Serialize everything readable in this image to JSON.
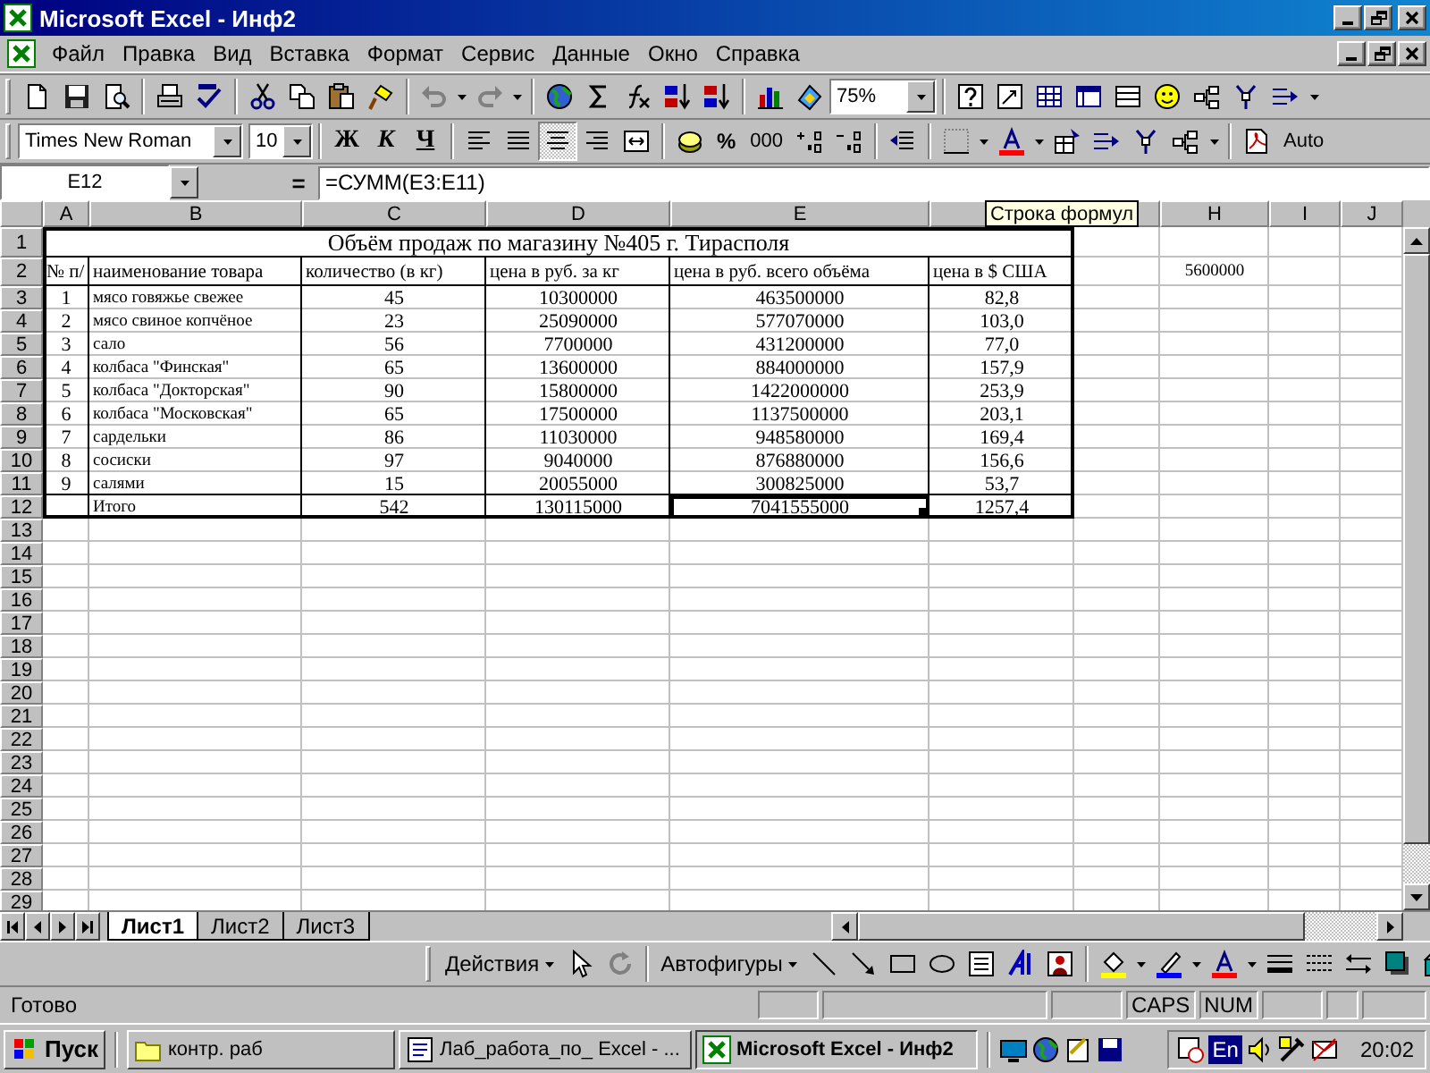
{
  "window": {
    "title": "Microsoft Excel - Инф2"
  },
  "menu": [
    "Файл",
    "Правка",
    "Вид",
    "Вставка",
    "Формат",
    "Сервис",
    "Данные",
    "Окно",
    "Справка"
  ],
  "standard_toolbar": {
    "zoom": "75%"
  },
  "formatting_toolbar": {
    "font": "Times New Roman",
    "size": "10",
    "style_buttons": [
      "Ж",
      "К",
      "Ч"
    ],
    "alignment": [
      {
        "kind": "left",
        "selected": false
      },
      {
        "kind": "justify",
        "selected": false
      },
      {
        "kind": "center",
        "selected": true
      },
      {
        "kind": "right",
        "selected": false
      }
    ],
    "percent": "%",
    "thousands": "000",
    "pdf_label": "Auto"
  },
  "formula_bar": {
    "name_box": "E12",
    "equals": "=",
    "formula": "=СУММ(E3:E11)"
  },
  "tooltip": "Строка формул",
  "sheet": {
    "column_headers": [
      "A",
      "B",
      "C",
      "D",
      "E",
      "H",
      "I",
      "J"
    ],
    "row_headers": [
      "1",
      "2",
      "3",
      "4",
      "5",
      "6",
      "7",
      "8",
      "9",
      "10",
      "11",
      "12",
      "13",
      "14",
      "15",
      "16",
      "17",
      "18",
      "19",
      "20",
      "21",
      "22",
      "23",
      "24",
      "25",
      "26",
      "27",
      "28",
      "29"
    ],
    "title": "Объём продаж по магазину №405 г. Тирасполя",
    "columns": [
      "№ п/",
      "наименование товара",
      "количество (в кг)",
      "цена в руб. за кг",
      "цена в руб. всего объёма",
      "цена в $ США"
    ],
    "rows": [
      [
        "1",
        "мясо говяжье свежее",
        "45",
        "10300000",
        "463500000",
        "82,8"
      ],
      [
        "2",
        "мясо свиное копчёное",
        "23",
        "25090000",
        "577070000",
        "103,0"
      ],
      [
        "3",
        "сало",
        "56",
        "7700000",
        "431200000",
        "77,0"
      ],
      [
        "4",
        "колбаса \"Финская\"",
        "65",
        "13600000",
        "884000000",
        "157,9"
      ],
      [
        "5",
        "колбаса \"Докторская\"",
        "90",
        "15800000",
        "1422000000",
        "253,9"
      ],
      [
        "6",
        "колбаса \"Московская\"",
        "65",
        "17500000",
        "1137500000",
        "203,1"
      ],
      [
        "7",
        "сардельки",
        "86",
        "11030000",
        "948580000",
        "169,4"
      ],
      [
        "8",
        "сосиски",
        "97",
        "9040000",
        "876880000",
        "156,6"
      ],
      [
        "9",
        "салями",
        "15",
        "20055000",
        "300825000",
        "53,7"
      ]
    ],
    "total": {
      "label": "Итого",
      "cells": [
        {
          "text": "542",
          "selected": false
        },
        {
          "text": "130115000",
          "selected": false
        },
        {
          "text": "7041555000",
          "selected": true
        },
        {
          "text": "1257,4",
          "selected": false
        }
      ]
    },
    "extra_cell": "5600000"
  },
  "sheet_tabs": [
    {
      "label": "Лист1",
      "selected": true
    },
    {
      "label": "Лист2",
      "selected": false
    },
    {
      "label": "Лист3",
      "selected": false
    }
  ],
  "drawing_toolbar": {
    "actions": "Действия",
    "autoshapes": "Автофигуры"
  },
  "status_bar": {
    "text": "Готово",
    "indicators": [
      "CAPS",
      "NUM"
    ]
  },
  "taskbar": {
    "start": "Пуск",
    "tasks": [
      {
        "kind": "folder",
        "label": "контр. раб",
        "selected": false
      },
      {
        "kind": "word",
        "label": "Лаб_работа_по_ Excel - ...",
        "selected": false
      },
      {
        "kind": "excel",
        "label": "Microsoft Excel - Инф2",
        "selected": true
      }
    ],
    "language": "En",
    "clock": "20:02"
  }
}
